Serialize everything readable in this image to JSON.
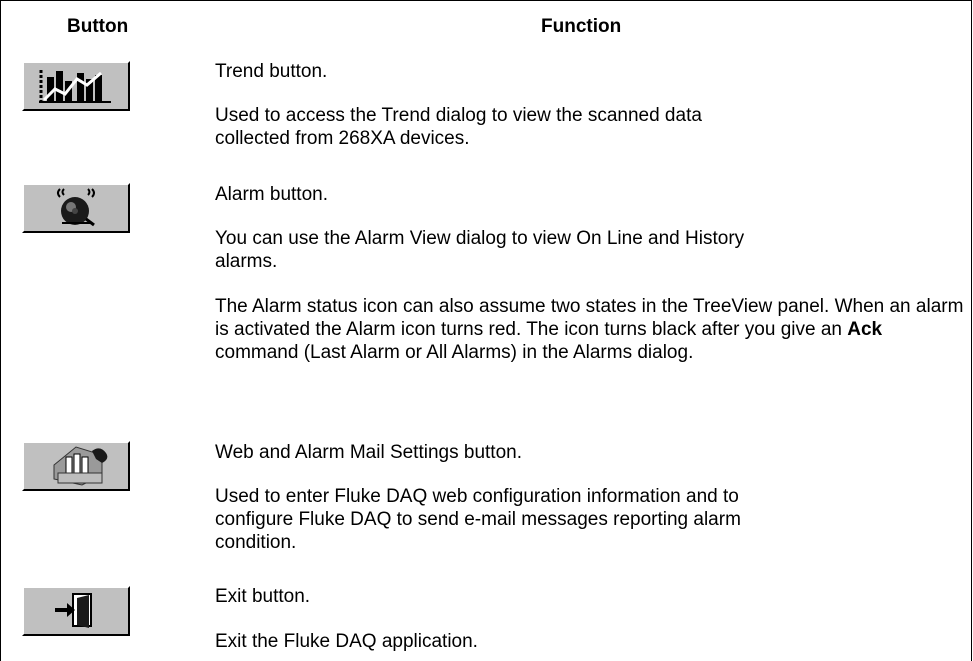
{
  "table": {
    "headers": {
      "button": "Button",
      "function": "Function"
    },
    "rows": [
      {
        "icon": "trend-chart-icon",
        "title": "Trend button.",
        "paragraphs": [
          "Used to access the Trend dialog to view the scanned data collected from 268XA devices."
        ]
      },
      {
        "icon": "alarm-bell-icon",
        "title": "Alarm button.",
        "paragraphs": [
          "You can use the Alarm View dialog to view On Line and History alarms.",
          "The Alarm status icon can also assume two states in the TreeView panel. When an alarm is activated the Alarm icon turns red. The icon turns black after you give an",
          "Ack",
          "command (Last Alarm or All Alarms) in the Alarms dialog."
        ]
      },
      {
        "icon": "web-mail-settings-icon",
        "title": "Web and Alarm Mail Settings button.",
        "paragraphs": [
          "Used to enter Fluke DAQ web configuration information and to configure Fluke DAQ to send e-mail messages reporting alarm condition."
        ]
      },
      {
        "icon": "exit-door-icon",
        "title": "Exit button.",
        "paragraphs": [
          "Exit the Fluke DAQ application."
        ]
      }
    ]
  }
}
